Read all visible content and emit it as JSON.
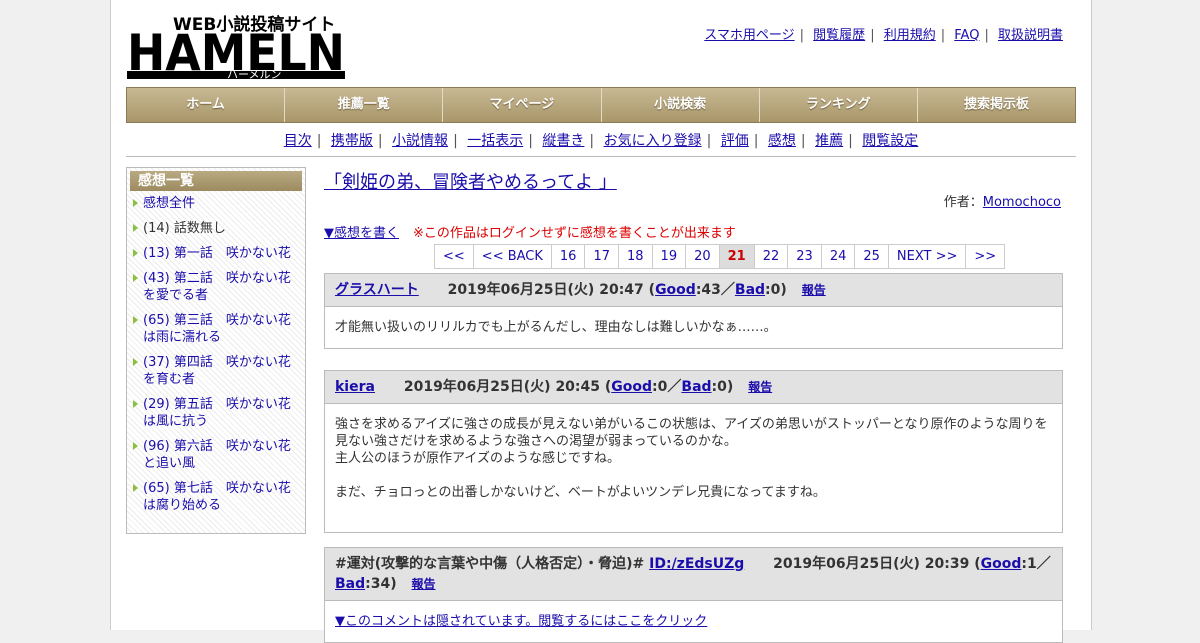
{
  "logo": {
    "tagline": "WEB小説投稿サイト",
    "wordmark": "HAMELN",
    "kana": "ハーメルン"
  },
  "toplinks": [
    "スマホ用ページ",
    "閲覧履歴",
    "利用規約",
    "FAQ",
    "取扱説明書"
  ],
  "nav": [
    "ホーム",
    "推薦一覧",
    "マイページ",
    "小説検索",
    "ランキング",
    "捜索掲示板"
  ],
  "subnav": [
    "目次",
    "携帯版",
    "小説情報",
    "一括表示",
    "縦書き",
    "お気に入り登録",
    "評価",
    "感想",
    "推薦",
    "閲覧設定"
  ],
  "sidebar": {
    "title": "感想一覧",
    "items": [
      {
        "label": "感想全件",
        "link": true
      },
      {
        "label": "(14) 話数無し",
        "link": false
      },
      {
        "label": "(13) 第一話　咲かない花",
        "link": true
      },
      {
        "label": "(43) 第二話　咲かない花を愛でる者",
        "link": true
      },
      {
        "label": "(65) 第三話　咲かない花は雨に濡れる",
        "link": true
      },
      {
        "label": "(37) 第四話　咲かない花を育む者",
        "link": true
      },
      {
        "label": "(29) 第五話　咲かない花は風に抗う",
        "link": true
      },
      {
        "label": "(96) 第六話　咲かない花と追い風",
        "link": true
      },
      {
        "label": "(65) 第七話　咲かない花は腐り始める",
        "link": true
      }
    ]
  },
  "main": {
    "title": "「剣姫の弟、冒険者やめるってよ 」",
    "author_label": "作者：",
    "author": "Momochoco",
    "write_link": "▼感想を書く",
    "notice": "※この作品はログインせずに感想を書くことが出来ます",
    "pager": [
      "<<",
      "<< BACK",
      "16",
      "17",
      "18",
      "19",
      "20",
      "21",
      "22",
      "23",
      "24",
      "25",
      "NEXT >>",
      ">>"
    ],
    "current_page": "21"
  },
  "comments": [
    {
      "user": "グラスハート",
      "date": "2019年06月25日(火) 20:47",
      "good_label": "Good",
      "good": "43",
      "bad_label": "Bad",
      "bad": "0",
      "report": "報告",
      "lines": [
        "才能無い扱いのリリルカでも上がるんだし、理由なしは難しいかなぁ……。"
      ]
    },
    {
      "user": "kiera",
      "date": "2019年06月25日(火) 20:45",
      "good_label": "Good",
      "good": "0",
      "bad_label": "Bad",
      "bad": "0",
      "report": "報告",
      "lines": [
        "強さを求めるアイズに強さの成長が見えない弟がいるこの状態は、アイズの弟思いがストッパーとなり原作のような周りを見ない強さだけを求めるような強さへの渇望が弱まっているのかな。",
        "主人公のほうが原作アイズのような感じですね。",
        "",
        "まだ、チョロっとの出番しかないけど、ベートがよいツンデレ兄貴になってますね。"
      ]
    },
    {
      "prefix": "#運対(攻撃的な言葉や中傷（人格否定）・脅迫)#",
      "user": "ID:/zEdsUZg",
      "date": "2019年06月25日(火) 20:39",
      "good_label": "Good",
      "good": "1",
      "bad_label": "Bad",
      "bad": "34",
      "report": "報告",
      "hidden": "▼このコメントは隠されています。閲覧するにはここをクリック"
    }
  ]
}
